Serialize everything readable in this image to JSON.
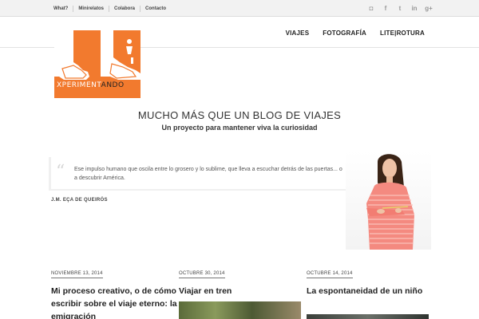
{
  "topnav": {
    "items": [
      "What?",
      "Minirelatos",
      "Colabora",
      "Contacto"
    ]
  },
  "social": {
    "icons": [
      "instagram-icon",
      "facebook-icon",
      "twitter-icon",
      "linkedin-icon",
      "googleplus-icon"
    ],
    "glyphs": [
      "◘",
      "f",
      "t",
      "in",
      "g+"
    ]
  },
  "logo": {
    "text_light": "XPERIMENT",
    "text_dark": "ANDO"
  },
  "mainnav": {
    "items": [
      "VIAJES",
      "FOTOGRAFÍA",
      "LITE|ROTURA"
    ]
  },
  "hero": {
    "title": "MUCHO MÁS QUE UN BLOG DE VIAJES",
    "subtitle": "Un proyecto para mantener viva la curiosidad"
  },
  "quote": {
    "mark": "“",
    "text": "Ese impulso humano que oscila entre lo grosero y lo sublime, que lleva a escuchar detrás de las puertas... o a descubrir América.",
    "author": "J.M. EÇA DE QUEIRÓS"
  },
  "posts": [
    {
      "date": "NOVIEMBRE 13, 2014",
      "title": "Mi proceso creativo, o de cómo escribir sobre el viaje eterno: la emigración"
    },
    {
      "date": "OCTUBRE 30, 2014",
      "title": "Viajar en tren"
    },
    {
      "date": "OCTUBRE 14, 2014",
      "title": "La espontaneidad de un niño"
    }
  ],
  "colors": {
    "accent": "#f27a2e",
    "topbar": "#f2f2f2"
  }
}
